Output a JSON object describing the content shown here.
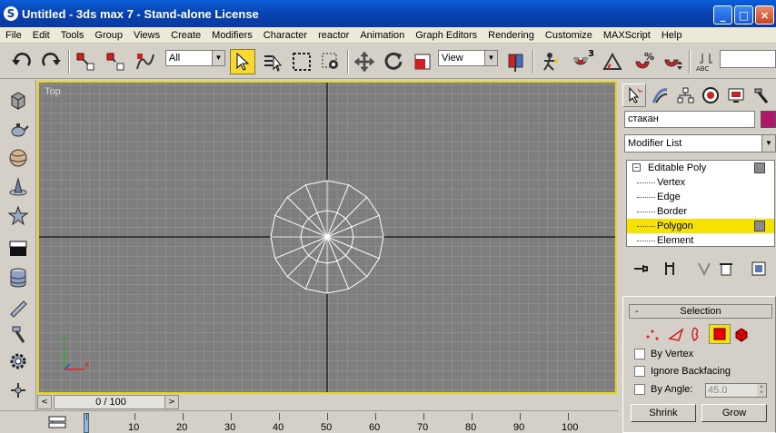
{
  "window": {
    "title": "Untitled - 3ds max 7  - Stand-alone License",
    "controls": [
      "_",
      "□",
      "×"
    ]
  },
  "menu": [
    "File",
    "Edit",
    "Tools",
    "Group",
    "Views",
    "Create",
    "Modifiers",
    "Character",
    "reactor",
    "Animation",
    "Graph Editors",
    "Rendering",
    "Customize",
    "MAXScript",
    "Help"
  ],
  "toolbar": {
    "selection_filter": "All",
    "reference_coord": "View",
    "snap_label": "3"
  },
  "viewport": {
    "label": "Top",
    "axis_y": "y",
    "axis_x": "x",
    "background": "#7e7e7e",
    "border_color": "#e4d41e"
  },
  "timeline": {
    "frame_display": "0 / 100",
    "prev": "<",
    "next": ">",
    "ticks": [
      "0",
      "10",
      "20",
      "30",
      "40",
      "50",
      "60",
      "70",
      "80",
      "90",
      "100"
    ]
  },
  "command_panel": {
    "object_name": "стакан",
    "object_color": "#b0176a",
    "modifier_list": "Modifier List",
    "stack": [
      {
        "label": "Editable Poly",
        "root": true
      },
      {
        "label": "Vertex"
      },
      {
        "label": "Edge"
      },
      {
        "label": "Border"
      },
      {
        "label": "Polygon",
        "selected": true
      },
      {
        "label": "Element"
      }
    ],
    "selection_rollout": {
      "minus": "-",
      "title": "Selection",
      "by_vertex": "By Vertex",
      "ignore_backfacing": "Ignore Backfacing",
      "by_angle": "By Angle:",
      "angle_value": "45.0",
      "shrink": "Shrink",
      "grow": "Grow"
    }
  }
}
